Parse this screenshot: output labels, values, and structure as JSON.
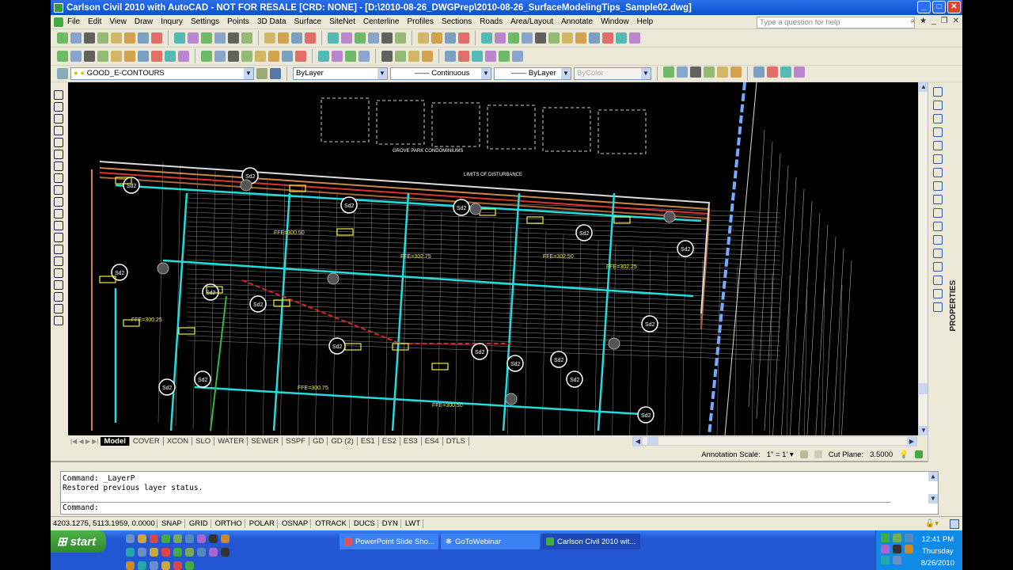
{
  "window": {
    "title": "Carlson Civil 2010 with AutoCAD - NOT FOR RESALE [CRD: NONE] - [D:\\2010-08-26_DWGPrep\\2010-08-26_SurfaceModelingTips_Sample02.dwg]"
  },
  "menu": [
    "File",
    "Edit",
    "View",
    "Draw",
    "Inqury",
    "Settings",
    "Points",
    "3D Data",
    "Surface",
    "SiteNet",
    "Centerline",
    "Profiles",
    "Sections",
    "Roads",
    "Area/Layout",
    "Annotate",
    "Window",
    "Help"
  ],
  "help": {
    "placeholder": "Type a question for help"
  },
  "properties_toolbar": {
    "layer": "GOOD_E-CONTOURS",
    "color": "ByLayer",
    "linetype": "Continuous",
    "lineweight": "ByLayer",
    "plotstyle": "ByColor"
  },
  "drawing": {
    "labels": [
      "GROVE PARK CONDOMINIUMS",
      "LIMITS OF DISTURBANCE",
      "FFE=300.50",
      "FFE=302.75",
      "FFE=302.50",
      "FFE=302.25",
      "FFE=300.25",
      "FFE=300.75",
      "Sd2"
    ]
  },
  "layout_tabs": [
    "Model",
    "COVER",
    "XCON",
    "SLO",
    "WATER",
    "SEWER",
    "SSPF",
    "GD",
    "GD (2)",
    "ES1",
    "ES2",
    "ES3",
    "ES4",
    "DTLS"
  ],
  "annotation": {
    "label": "Annotation Scale:",
    "scale": "1\" = 1'",
    "cut_plane_label": "Cut Plane:",
    "cut_plane": "3.5000"
  },
  "palette": {
    "title": "PROPERTIES"
  },
  "command": {
    "lines": [
      "Command:  _LayerP",
      "Restored previous layer status."
    ],
    "prompt": "Command:"
  },
  "status": {
    "coords": "4203.1275, 5113.1959, 0.0000",
    "toggles": [
      "SNAP",
      "GRID",
      "ORTHO",
      "POLAR",
      "OSNAP",
      "OTRACK",
      "DUCS",
      "DYN",
      "LWT"
    ]
  },
  "taskbar": {
    "start": "start",
    "tasks": [
      "PowerPoint Slide Sho...",
      "GoToWebinar",
      "Carlson Civil 2010 wit..."
    ],
    "time": "12:41 PM",
    "day": "Thursday",
    "date": "8/26/2010"
  }
}
